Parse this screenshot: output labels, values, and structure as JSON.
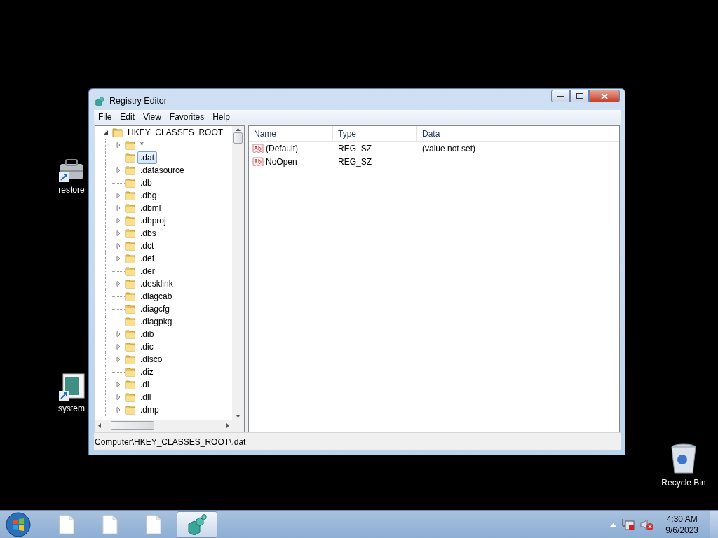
{
  "desktop_icons": [
    {
      "kind": "toolbox",
      "label": "restore"
    },
    {
      "kind": "picture",
      "label": "system"
    },
    {
      "kind": "bin",
      "label": "Recycle Bin"
    }
  ],
  "window": {
    "title": "Registry Editor",
    "menu": [
      "File",
      "Edit",
      "View",
      "Favorites",
      "Help"
    ],
    "tree": {
      "label": "HKEY_CLASSES_ROOT",
      "expanded": true,
      "children": [
        {
          "label": "*",
          "expandable": true,
          "selected": false
        },
        {
          "label": ".dat",
          "expandable": false,
          "selected": true
        },
        {
          "label": ".datasource",
          "expandable": true,
          "selected": false
        },
        {
          "label": ".db",
          "expandable": false,
          "selected": false
        },
        {
          "label": ".dbg",
          "expandable": true,
          "selected": false
        },
        {
          "label": ".dbml",
          "expandable": true,
          "selected": false
        },
        {
          "label": ".dbproj",
          "expandable": true,
          "selected": false
        },
        {
          "label": ".dbs",
          "expandable": true,
          "selected": false
        },
        {
          "label": ".dct",
          "expandable": true,
          "selected": false
        },
        {
          "label": ".def",
          "expandable": true,
          "selected": false
        },
        {
          "label": ".der",
          "expandable": false,
          "selected": false
        },
        {
          "label": ".desklink",
          "expandable": true,
          "selected": false
        },
        {
          "label": ".diagcab",
          "expandable": false,
          "selected": false
        },
        {
          "label": ".diagcfg",
          "expandable": false,
          "selected": false
        },
        {
          "label": ".diagpkg",
          "expandable": false,
          "selected": false
        },
        {
          "label": ".dib",
          "expandable": true,
          "selected": false
        },
        {
          "label": ".dic",
          "expandable": true,
          "selected": false
        },
        {
          "label": ".disco",
          "expandable": true,
          "selected": false
        },
        {
          "label": ".diz",
          "expandable": false,
          "selected": false
        },
        {
          "label": ".dl_",
          "expandable": true,
          "selected": false
        },
        {
          "label": ".dll",
          "expandable": true,
          "selected": false
        },
        {
          "label": ".dmp",
          "expandable": true,
          "selected": false
        }
      ]
    },
    "list": {
      "columns": [
        "Name",
        "Type",
        "Data"
      ],
      "rows": [
        {
          "name": "(Default)",
          "type": "REG_SZ",
          "data": "(value not set)"
        },
        {
          "name": "NoOpen",
          "type": "REG_SZ"
        }
      ]
    },
    "status_bar": "Computer\\HKEY_CLASSES_ROOT\\.dat"
  },
  "taskbar": {
    "buttons": [
      {
        "kind": "document",
        "active": false
      },
      {
        "kind": "document",
        "active": false
      },
      {
        "kind": "document",
        "active": false
      },
      {
        "kind": "regedit",
        "active": true
      }
    ],
    "clock": {
      "time": "4:30 AM",
      "date": "9/6/2023"
    }
  }
}
